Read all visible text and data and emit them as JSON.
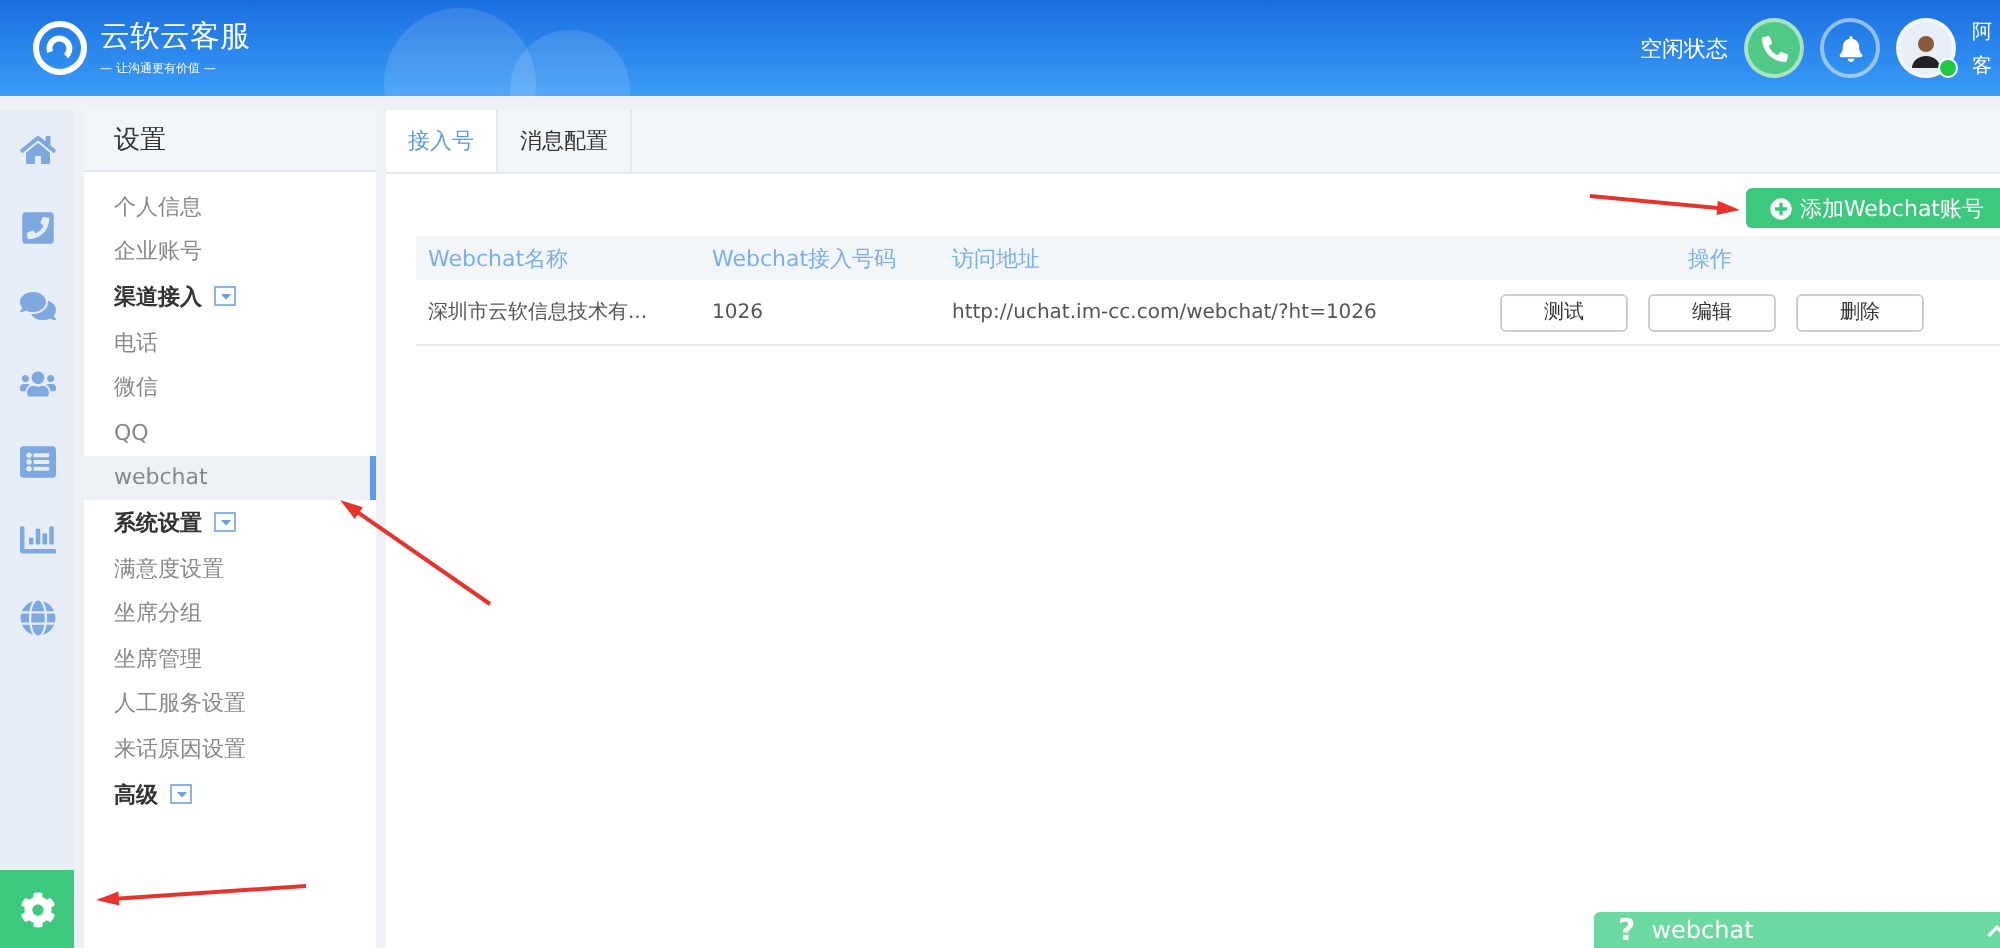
{
  "header": {
    "brand": "云软云客服",
    "slogan": "— 让沟通更有价值 —",
    "status": "空闲状态",
    "user_name": "阿",
    "user_role": "客",
    "online": true
  },
  "rail": [
    {
      "selected": false
    },
    {
      "selected": false
    },
    {
      "selected": false
    },
    {
      "selected": false
    },
    {
      "selected": false
    },
    {
      "selected": false
    },
    {
      "selected": false
    },
    {
      "selected": true
    }
  ],
  "sidebar": {
    "title": "设置",
    "items": [
      {
        "label": "个人信息",
        "kind": "item",
        "selected": false
      },
      {
        "label": "企业账号",
        "kind": "item",
        "selected": false
      },
      {
        "label": "渠道接入",
        "kind": "group",
        "selected": false
      },
      {
        "label": "电话",
        "kind": "item",
        "selected": false
      },
      {
        "label": "微信",
        "kind": "item",
        "selected": false
      },
      {
        "label": "QQ",
        "kind": "item",
        "selected": false
      },
      {
        "label": "webchat",
        "kind": "item",
        "selected": true
      },
      {
        "label": "系统设置",
        "kind": "group",
        "selected": false
      },
      {
        "label": "满意度设置",
        "kind": "item",
        "selected": false
      },
      {
        "label": "坐席分组",
        "kind": "item",
        "selected": false
      },
      {
        "label": "坐席管理",
        "kind": "item",
        "selected": false
      },
      {
        "label": "人工服务设置",
        "kind": "item",
        "selected": false
      },
      {
        "label": "来话原因设置",
        "kind": "item",
        "selected": false
      },
      {
        "label": "高级",
        "kind": "group",
        "selected": false
      }
    ]
  },
  "tabs": [
    {
      "label": "接入号",
      "selected": true
    },
    {
      "label": "消息配置",
      "selected": false
    }
  ],
  "add_button": "添加Webchat账号",
  "table": {
    "columns": [
      "Webchat名称",
      "Webchat接入号码",
      "访问地址",
      "操作"
    ],
    "rows": [
      {
        "name": "深圳市云软信息技术有...",
        "number": "1026",
        "url": "http://uchat.im-cc.com/webchat/?ht=1026",
        "actions": [
          "测试",
          "编辑",
          "删除"
        ]
      }
    ]
  },
  "chat_widget": {
    "icon": "?",
    "label": "webchat"
  }
}
